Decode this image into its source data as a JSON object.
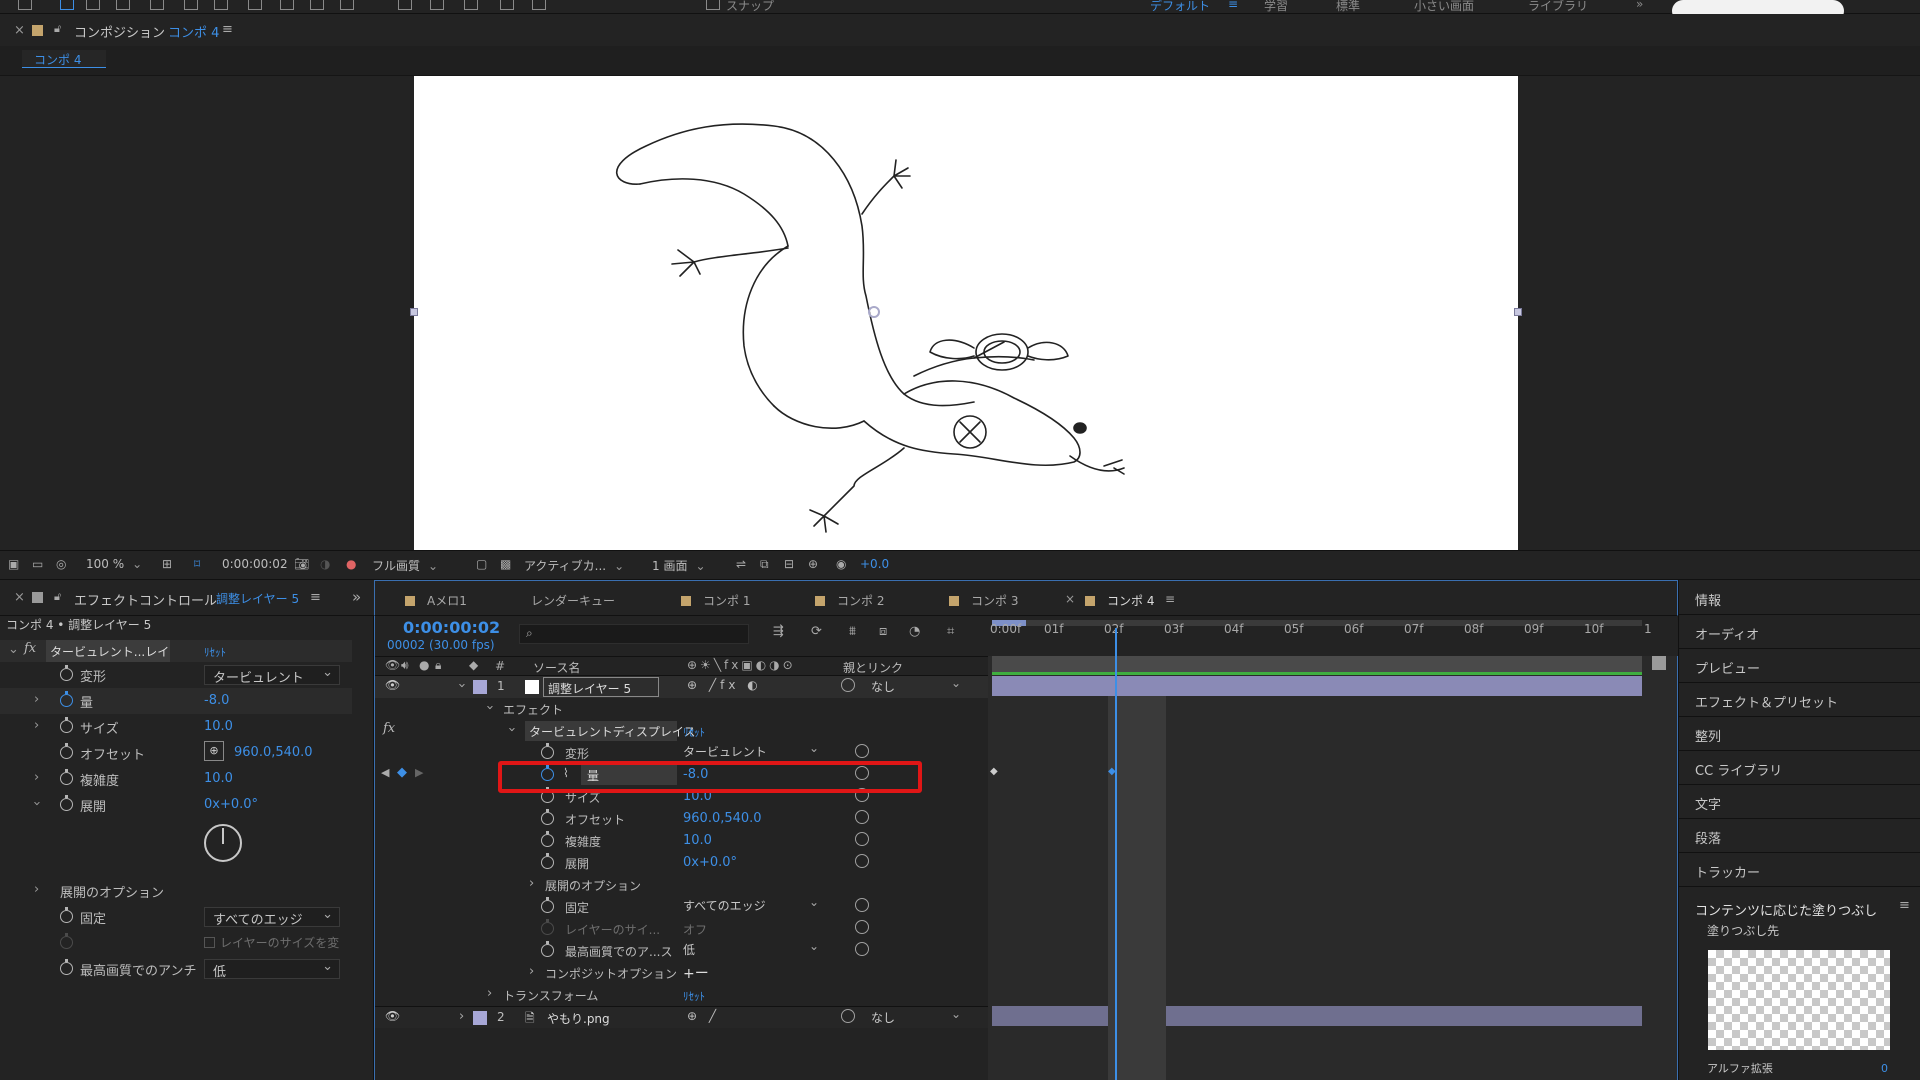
{
  "toolbar": {
    "workspaces": [
      "デフォルト",
      "学習",
      "標準",
      "小さい画面",
      "ライブラリ"
    ],
    "snap_label": "スナップ"
  },
  "viewer": {
    "panel_title": "コンポジション",
    "comp_name": "コンポ 4",
    "tab_label": "コンポ 4",
    "zoom": "100 %",
    "timecode": "0:00:00:02",
    "resolution": "フル画質",
    "camera": "アクティブカ...",
    "views": "1 画面",
    "exposure": "+0.0"
  },
  "effect_controls": {
    "panel_title": "エフェクトコントロール",
    "layer_name": "調整レイヤー 5",
    "breadcrumb": "コンポ 4 • 調整レイヤー 5",
    "effect_name": "タービュレント...レイス",
    "reset": "ﾘｾｯﾄ",
    "props": {
      "displace_label": "変形",
      "displace_value": "タービュレント",
      "amount_label": "量",
      "amount_value": "-8.0",
      "size_label": "サイズ",
      "size_value": "10.0",
      "offset_label": "オフセット",
      "offset_value": "960.0,540.0",
      "complexity_label": "複雑度",
      "complexity_value": "10.0",
      "evolution_label": "展開",
      "evolution_value": "0x+0.0°",
      "evo_options_label": "展開のオプション",
      "pinning_label": "固定",
      "pinning_value": "すべてのエッジ",
      "resize_label": "レイヤーのサイズを変",
      "antialias_label": "最高画質でのアンチ",
      "antialias_value": "低"
    }
  },
  "timeline": {
    "tabs": [
      "Aメロ1",
      "レンダーキュー",
      "コンポ 1",
      "コンポ 2",
      "コンポ 3",
      "コンポ 4"
    ],
    "active_tab": "コンポ 4",
    "timecode": "0:00:00:02",
    "frame_fps": "00002 (30.00 fps)",
    "search_placeholder": "",
    "col_source": "ソース名",
    "col_parent": "親とリンク",
    "ruler": [
      "0:00f",
      "01f",
      "02f",
      "03f",
      "04f",
      "05f",
      "06f",
      "07f",
      "08f",
      "09f",
      "10f",
      "1"
    ],
    "layers": [
      {
        "num": "1",
        "name": "調整レイヤー 5",
        "parent": "なし"
      },
      {
        "num": "2",
        "name": "やもり.png",
        "parent": "なし"
      }
    ],
    "groups": {
      "effects": "エフェクト",
      "effect_name": "タービュレントディスプレイス",
      "reset": "ﾘｾｯﾄ",
      "transform": "トランスフォーム",
      "composite_options": "コンポジットオプション",
      "composite_value": "+ー"
    },
    "props": {
      "displace_label": "変形",
      "displace_value": "タービュレント",
      "amount_label": "量",
      "amount_value": "-8.0",
      "size_label": "サイズ",
      "size_value": "10.0",
      "offset_label": "オフセット",
      "offset_value": "960.0,540.0",
      "complexity_label": "複雑度",
      "complexity_value": "10.0",
      "evolution_label": "展開",
      "evolution_value": "0x+0.0°",
      "evo_options_label": "展開のオプション",
      "pinning_label": "固定",
      "pinning_value": "すべてのエッジ",
      "resize_label": "レイヤーのサイ...",
      "resize_value": "オフ",
      "antialias_label": "最高画質でのア...ス",
      "antialias_value": "低"
    }
  },
  "right_panel": {
    "items": [
      "情報",
      "オーディオ",
      "プレビュー",
      "エフェクト＆プリセット",
      "整列",
      "CC ライブラリ",
      "文字",
      "段落",
      "トラッカー"
    ],
    "fill_title": "コンテンツに応じた塗りつぶし",
    "fill_target": "塗りつぶし先",
    "alpha_label": "アルファ拡張",
    "alpha_value": "0"
  }
}
